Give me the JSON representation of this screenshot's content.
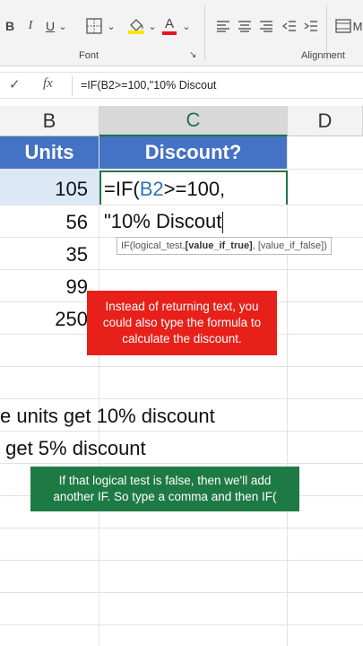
{
  "ribbon": {
    "font_group_label": "Font",
    "alignment_group_label": "Alignment",
    "bold_label": "B",
    "italic_label": "I",
    "underline_label": "U",
    "dropdown_glyph": "⌄",
    "borders_icon": "borders-icon",
    "fill_icon": "fill-color-icon",
    "font_color_label": "A",
    "fill_color": "#f7e600",
    "font_color": "#e81123",
    "launcher_glyph": "↘"
  },
  "formula_bar": {
    "enter_glyph": "✓",
    "fx_label": "fx",
    "content": "=IF(B2>=100,\"10% Discout"
  },
  "columns": {
    "b": "B",
    "c": "C",
    "d": "D"
  },
  "table": {
    "header_units": "Units",
    "header_discount": "Discount?",
    "header_color": "#4472c4",
    "units": [
      "105",
      "56",
      "35",
      "99",
      "250"
    ]
  },
  "editing": {
    "line1_prefix": "=IF(",
    "line1_ref": "B2",
    "line1_suffix": ">=100,",
    "line2": "\"10% Discout",
    "ref_color": "#2e75b6"
  },
  "tooltip": {
    "func": "IF(logical_test, ",
    "current_arg": "[value_if_true]",
    "rest": ", [value_if_false])"
  },
  "notes": {
    "line1": "e units get 10% discount",
    "line2": " get 5% discount"
  },
  "callouts": {
    "red_text": "Instead of returning text, you could also type the formula to calculate the discount.",
    "green_text": "If that logical test is false, then we'll add another IF. So type a comma and then IF("
  }
}
